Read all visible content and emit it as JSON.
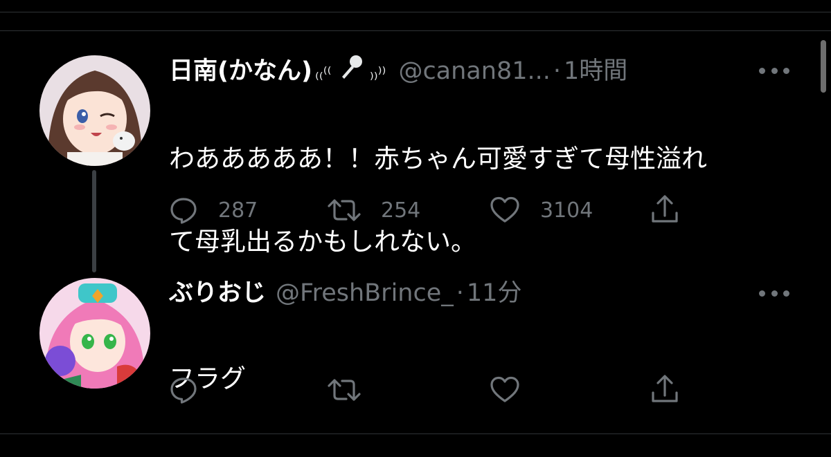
{
  "colors": {
    "background": "#000000",
    "text": "#ffffff",
    "secondary": "#71767b",
    "divider": "#2f3336"
  },
  "tweets": [
    {
      "display_name": "日南(かなん)",
      "name_decoration_left": "₍₍⁽⁽",
      "name_icon": "microphone-icon",
      "name_decoration_right": "₎₎⁾⁾",
      "handle": "@canan81...",
      "separator": "·",
      "time": "1時間",
      "text_line1": "わあああああ！！赤ちゃん可愛すぎて母性溢れ",
      "text_line2": "て母乳出るかもしれない。",
      "actions": {
        "reply": {
          "icon": "reply-icon",
          "count": "287"
        },
        "retweet": {
          "icon": "retweet-icon",
          "count": "254"
        },
        "like": {
          "icon": "heart-icon",
          "count": "3104"
        },
        "share": {
          "icon": "share-icon"
        }
      }
    },
    {
      "display_name": "ぶりおじ",
      "handle": "@FreshBrince_",
      "separator": "·",
      "time": "11分",
      "text_line1": "フラグ",
      "actions": {
        "reply": {
          "icon": "reply-icon"
        },
        "retweet": {
          "icon": "retweet-icon"
        },
        "like": {
          "icon": "heart-icon"
        },
        "share": {
          "icon": "share-icon"
        }
      }
    }
  ]
}
